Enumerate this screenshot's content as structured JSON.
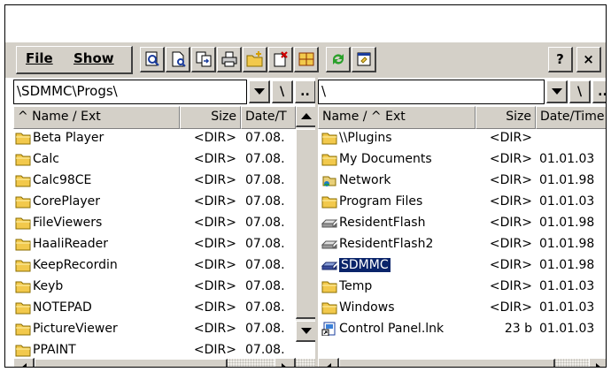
{
  "menu": {
    "file": "File",
    "show": "Show"
  },
  "toolbar_icons": [
    "find-icon",
    "new-file-icon",
    "copy-icon",
    "print-icon",
    "new-folder-icon",
    "delete-icon",
    "grid-icon",
    "refresh-icon",
    "properties-icon"
  ],
  "window_buttons": {
    "help": "?",
    "close": "×"
  },
  "left": {
    "path": "\\SDMMC\\Progs\\",
    "root_button": "\\",
    "up_button": "..",
    "columns": {
      "name": "^ Name / Ext",
      "size": "Size",
      "date": "Date/T"
    },
    "rows": [
      {
        "name": "Beta Player",
        "size": "<DIR>",
        "date": "07.08."
      },
      {
        "name": "Calc",
        "size": "<DIR>",
        "date": "07.08."
      },
      {
        "name": "Calc98CE",
        "size": "<DIR>",
        "date": "07.08."
      },
      {
        "name": "CorePlayer",
        "size": "<DIR>",
        "date": "07.08."
      },
      {
        "name": "FileViewers",
        "size": "<DIR>",
        "date": "07.08."
      },
      {
        "name": "HaaliReader",
        "size": "<DIR>",
        "date": "07.08."
      },
      {
        "name": "KeepRecordin",
        "size": "<DIR>",
        "date": "07.08."
      },
      {
        "name": "Keyb",
        "size": "<DIR>",
        "date": "07.08."
      },
      {
        "name": "NOTEPAD",
        "size": "<DIR>",
        "date": "07.08."
      },
      {
        "name": "PictureViewer",
        "size": "<DIR>",
        "date": "07.08."
      },
      {
        "name": "PPAINT",
        "size": "<DIR>",
        "date": "07.08."
      }
    ]
  },
  "right": {
    "path": "\\",
    "root_button": "\\",
    "up_button": "..",
    "columns": {
      "name": "Name / ^ Ext",
      "size": "Size",
      "date": "Date/Time"
    },
    "rows": [
      {
        "name": "\\\\Plugins",
        "size": "<DIR>",
        "date": "",
        "icon": "folder-icon"
      },
      {
        "name": "My Documents",
        "size": "<DIR>",
        "date": "01.01.03",
        "icon": "folder-icon"
      },
      {
        "name": "Network",
        "size": "<DIR>",
        "date": "01.01.98",
        "icon": "network-icon"
      },
      {
        "name": "Program Files",
        "size": "<DIR>",
        "date": "01.01.03",
        "icon": "folder-icon"
      },
      {
        "name": "ResidentFlash",
        "size": "<DIR>",
        "date": "01.01.98",
        "icon": "drive-icon"
      },
      {
        "name": "ResidentFlash2",
        "size": "<DIR>",
        "date": "01.01.98",
        "icon": "drive-icon"
      },
      {
        "name": "SDMMC",
        "size": "<DIR>",
        "date": "01.01.98",
        "icon": "card-icon",
        "selected": true
      },
      {
        "name": "Temp",
        "size": "<DIR>",
        "date": "01.01.03",
        "icon": "folder-icon"
      },
      {
        "name": "Windows",
        "size": "<DIR>",
        "date": "01.01.03",
        "icon": "folder-icon"
      },
      {
        "name": "Control Panel.lnk",
        "size": "23 b",
        "date": "01.01.03",
        "icon": "shortcut-icon"
      }
    ]
  },
  "colors": {
    "chrome": "#d4d0c8",
    "selection": "#0a246a",
    "folder": "#f2c94c"
  }
}
